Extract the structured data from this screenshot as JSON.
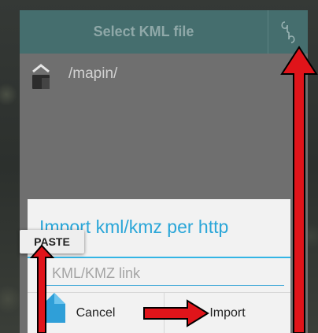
{
  "chooser": {
    "title": "Select KML file",
    "action_icon": "link-icon",
    "up_icon": "folder-up-icon",
    "path": "/mapin/"
  },
  "import_dialog": {
    "title": "Import kml/kmz per http",
    "input_placeholder": "KML/KMZ link",
    "input_value": "",
    "cancel_label": "Cancel",
    "import_label": "Import"
  },
  "context": {
    "paste_label": "PASTE"
  },
  "colors": {
    "header_bg": "#456e6e",
    "accent": "#2aa6d8",
    "arrow_fill": "#e0141a"
  }
}
